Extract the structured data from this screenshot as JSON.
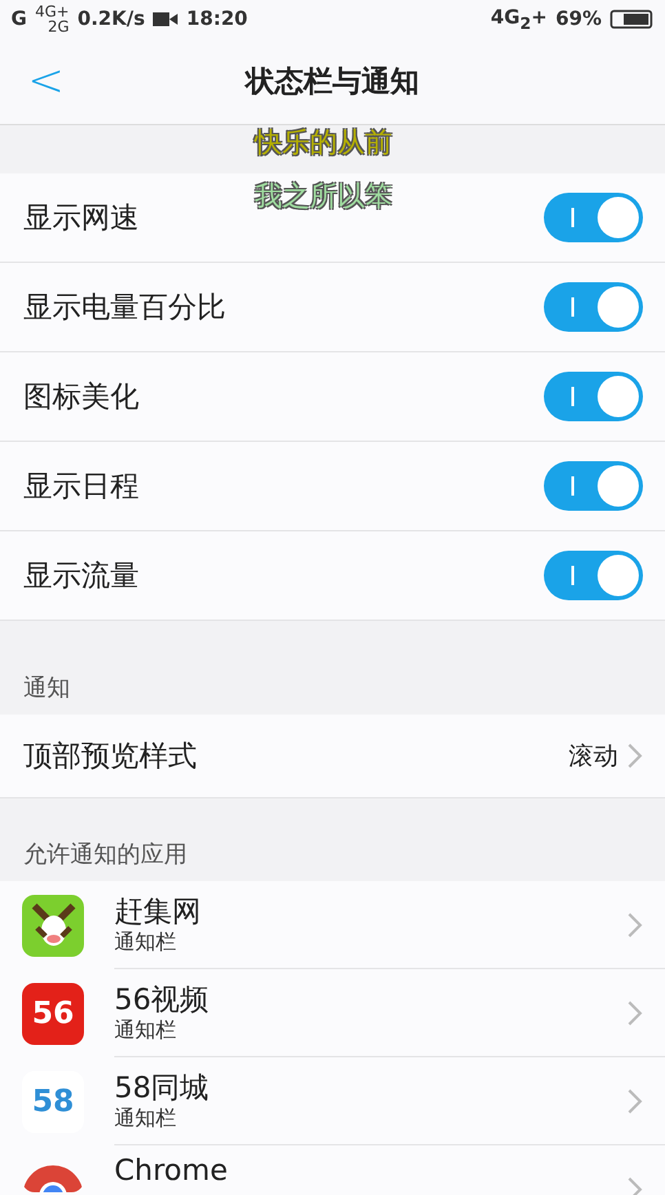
{
  "status_bar": {
    "sim1": "G",
    "sim2_top": "4G+",
    "sim2_bottom": "2G",
    "speed": "0.2K/s",
    "time": "18:20",
    "network": "4G$_{2}$+",
    "battery": "69%"
  },
  "header": {
    "back": "<",
    "title": "状态栏与通知"
  },
  "overlay_caption": [
    {
      "text": "快乐的从前",
      "color": "#b5b000"
    },
    {
      "text": "我之所以笨",
      "color": "#9fdc9f"
    }
  ],
  "toggles": [
    {
      "label": "显示网速",
      "on": true
    },
    {
      "label": "显示电量百分比",
      "on": true
    },
    {
      "label": "图标美化",
      "on": true
    },
    {
      "label": "显示日程",
      "on": true
    },
    {
      "label": "显示流量",
      "on": true
    }
  ],
  "notify_section": {
    "title": "通知",
    "row": {
      "label": "顶部预览样式",
      "value": "滚动"
    }
  },
  "apps_section": {
    "title": "允许通知的应用",
    "apps": [
      {
        "name": "赶集网",
        "sub": "通知栏",
        "kind": "donkey"
      },
      {
        "name": "56视频",
        "sub": "通知栏",
        "kind": "fiftysix",
        "icon_text": "56"
      },
      {
        "name": "58同城",
        "sub": "通知栏",
        "kind": "fiftyeight",
        "icon_text": "58"
      },
      {
        "name": "Chrome",
        "kind": "chrome"
      }
    ]
  }
}
